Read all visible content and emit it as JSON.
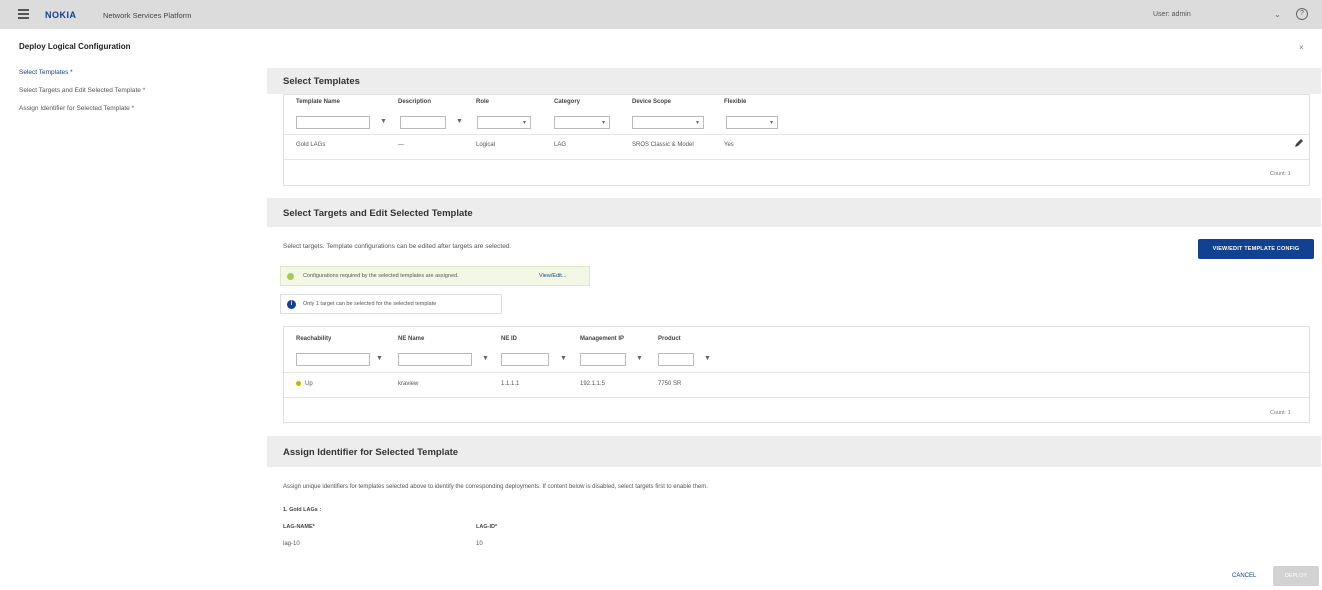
{
  "topbar": {
    "brand": "NOKIA",
    "product": "Network Services Platform",
    "user": "User: admin",
    "caret": "⌄",
    "help": "?"
  },
  "dialog": {
    "title": "Deploy Logical Configuration",
    "close": "×"
  },
  "nav": [
    {
      "label": "Select Templates *"
    },
    {
      "label": "Select Targets and Edit Selected Template *"
    },
    {
      "label": "Assign Identifier for Selected Template *"
    }
  ],
  "templates": {
    "heading": "Select Templates",
    "columns": [
      "Template Name",
      "Description",
      "Role",
      "Category",
      "Device Scope",
      "Flexible"
    ],
    "row": [
      "Gold LAGs",
      "—",
      "Logical",
      "LAG",
      "SROS Classic & Model",
      "Yes"
    ],
    "count": "Count: 1"
  },
  "targets": {
    "heading": "Select Targets and Edit Selected Template",
    "description": "Select targets. Template configurations can be edited after targets are selected.",
    "button": "VIEW/EDIT TEMPLATE CONFIG",
    "ok_banner": "Configurations required by the selected templates are assigned.",
    "ok_link": "View/Edit...",
    "info_banner": "Only 1 target can be selected for the selected template",
    "columns": [
      "Reachability",
      "NE Name",
      "NE ID",
      "Management IP",
      "Product"
    ],
    "row": [
      "Up",
      "kraview",
      "1.1.1.1",
      "192.1.1.5",
      "7750 SR"
    ],
    "count": "Count: 1"
  },
  "identifier": {
    "heading": "Assign Identifier for Selected Template",
    "description": "Assign unique identifiers for templates selected above to identify the corresponding deployments. If content below is disabled, select targets first to enable them.",
    "group": "1. Gold LAGs :",
    "field1_label": "LAG-NAME*",
    "field1_value": "lag-10",
    "field2_label": "LAG-ID*",
    "field2_value": "10"
  },
  "footer": {
    "cancel": "CANCEL",
    "deploy": "DEPLOY"
  },
  "colors": {
    "accent": "#124191",
    "ok": "#a8c84f",
    "status_up": "#c9b400"
  }
}
